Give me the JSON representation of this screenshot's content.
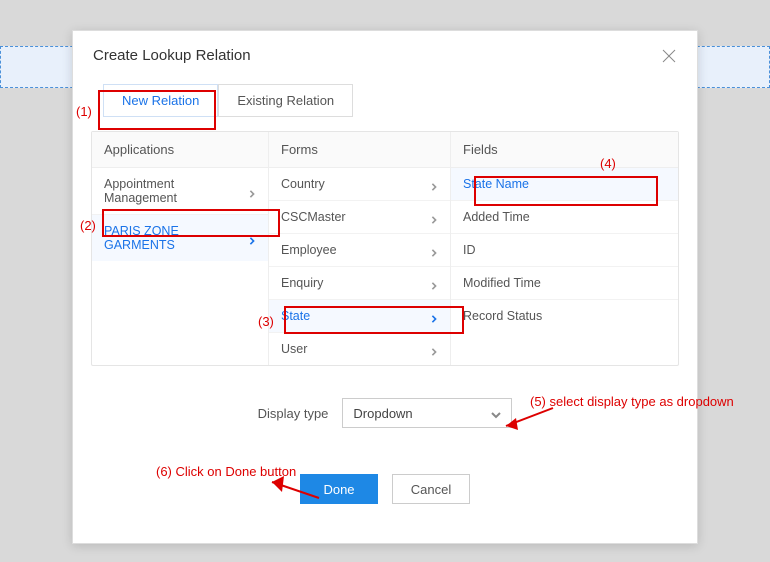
{
  "modal": {
    "title": "Create Lookup Relation",
    "tabs": {
      "new": "New Relation",
      "existing": "Existing Relation"
    },
    "columns": {
      "applications": {
        "header": "Applications",
        "items": [
          {
            "label": "Appointment Management",
            "selected": false
          },
          {
            "label": "PARIS ZONE GARMENTS",
            "selected": true
          }
        ]
      },
      "forms": {
        "header": "Forms",
        "items": [
          {
            "label": "Country",
            "selected": false
          },
          {
            "label": "CSCMaster",
            "selected": false
          },
          {
            "label": "Employee",
            "selected": false
          },
          {
            "label": "Enquiry",
            "selected": false
          },
          {
            "label": "State",
            "selected": true
          },
          {
            "label": "User",
            "selected": false
          }
        ]
      },
      "fields": {
        "header": "Fields",
        "items": [
          {
            "label": "State Name",
            "selected": true
          },
          {
            "label": "Added Time",
            "selected": false
          },
          {
            "label": "ID",
            "selected": false
          },
          {
            "label": "Modified Time",
            "selected": false
          },
          {
            "label": "Record Status",
            "selected": false
          }
        ]
      }
    },
    "display_type": {
      "label": "Display type",
      "value": "Dropdown"
    },
    "buttons": {
      "done": "Done",
      "cancel": "Cancel"
    }
  },
  "annotations": {
    "n1": "(1)",
    "n2": "(2)",
    "n3": "(3)",
    "n4": "(4)",
    "n5": "(5) select display type as dropdown",
    "n6": "(6) Click on Done button"
  }
}
